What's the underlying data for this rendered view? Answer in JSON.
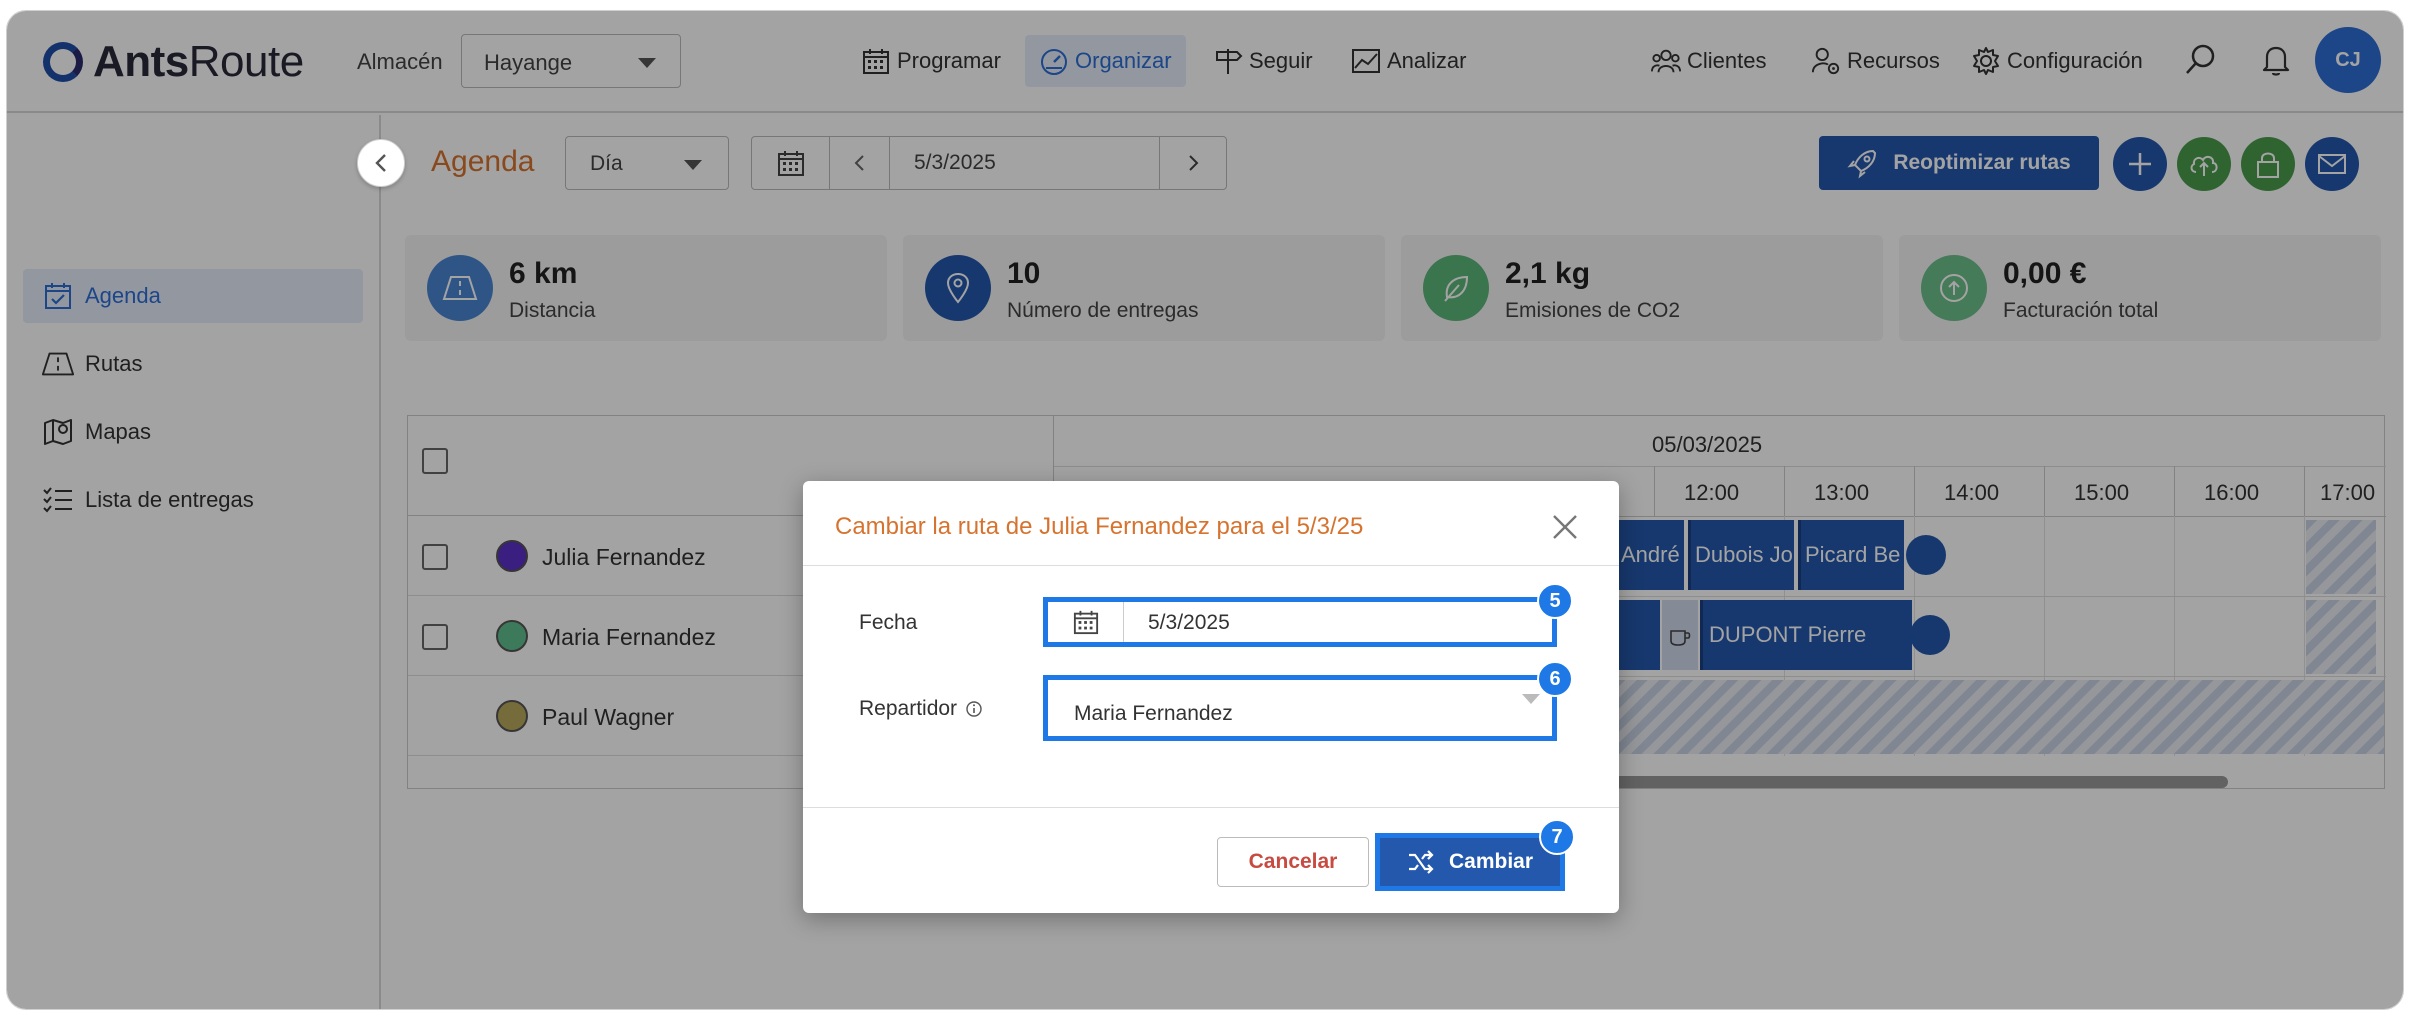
{
  "header": {
    "logo": {
      "brand_bold": "Ants",
      "brand_regular": "Route"
    },
    "warehouse_label": "Almacén",
    "warehouse_value": "Hayange",
    "nav": [
      {
        "label": "Programar",
        "icon": "calendar-icon"
      },
      {
        "label": "Organizar",
        "icon": "speedometer-icon",
        "active": true
      },
      {
        "label": "Seguir",
        "icon": "signpost-icon"
      },
      {
        "label": "Analizar",
        "icon": "chart-icon"
      }
    ],
    "right_nav": [
      {
        "label": "Clientes",
        "icon": "users-icon"
      },
      {
        "label": "Recursos",
        "icon": "user-gear-icon"
      },
      {
        "label": "Configuración",
        "icon": "gear-icon"
      }
    ],
    "avatar_initials": "CJ"
  },
  "sidebar": {
    "items": [
      {
        "label": "Agenda",
        "icon": "calendar-check-icon",
        "active": true
      },
      {
        "label": "Rutas",
        "icon": "road-icon"
      },
      {
        "label": "Mapas",
        "icon": "map-icon"
      },
      {
        "label": "Lista de entregas",
        "icon": "list-icon"
      }
    ]
  },
  "toolbar": {
    "title": "Agenda",
    "view_value": "Día",
    "date_value": "5/3/2025",
    "reoptimize_label": "Reoptimizar rutas"
  },
  "stats": [
    {
      "value": "6 km",
      "label": "Distancia",
      "color": "#4a86d4"
    },
    {
      "value": "10",
      "label": "Número de entregas",
      "color": "#2458ad"
    },
    {
      "value": "2,1 kg",
      "label": "Emisiones de CO2",
      "color": "#5cb87a"
    },
    {
      "value": "0,00 €",
      "label": "Facturación total",
      "color": "#6cc08a"
    }
  ],
  "timeline": {
    "date": "05/03/2025",
    "hours": [
      "12:00",
      "13:00",
      "14:00",
      "15:00",
      "16:00",
      "17:00"
    ]
  },
  "drivers": [
    {
      "name": "Julia Fernandez",
      "color": "#5b2fc9"
    },
    {
      "name": "Maria Fernandez",
      "color": "#5fbf8f"
    },
    {
      "name": "Paul Wagner",
      "color": "#b9a85c"
    }
  ],
  "tasks": {
    "row1": [
      "André",
      "Dubois Jo",
      "Picard Be"
    ],
    "row2": [
      "DUPONT Pierre"
    ]
  },
  "dialog": {
    "title": "Cambiar la ruta de Julia Fernandez para el 5/3/25",
    "date_label": "Fecha",
    "date_value": "5/3/2025",
    "driver_label": "Repartidor",
    "driver_value": "Maria Fernandez",
    "cancel_label": "Cancelar",
    "change_label": "Cambiar",
    "badges": [
      "5",
      "6",
      "7"
    ]
  },
  "colors": {
    "accent": "#2458ad",
    "highlight": "#1e78e6",
    "title_orange": "#d6732e"
  }
}
